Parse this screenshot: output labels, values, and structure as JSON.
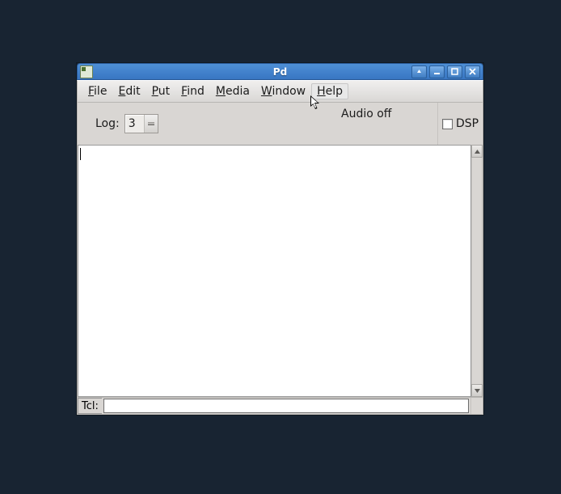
{
  "titlebar": {
    "title": "Pd"
  },
  "menubar": {
    "file": {
      "accel": "F",
      "rest": "ile"
    },
    "edit": {
      "accel": "E",
      "rest": "dit"
    },
    "put": {
      "accel": "P",
      "rest": "ut"
    },
    "find": {
      "accel": "F",
      "rest": "ind"
    },
    "media": {
      "accel": "M",
      "rest": "edia"
    },
    "window": {
      "accel": "W",
      "rest": "indow"
    },
    "help": {
      "accel": "H",
      "rest": "elp"
    }
  },
  "toolbar": {
    "log_label": "Log:",
    "log_value": "3",
    "audio_status": "Audio off",
    "dsp_label": "DSP",
    "dsp_checked": false
  },
  "tcl": {
    "label": "Tcl:",
    "value": ""
  },
  "icons": {
    "shade": "shade-icon",
    "minimize": "minimize-icon",
    "maximize": "maximize-icon",
    "close": "close-icon"
  }
}
